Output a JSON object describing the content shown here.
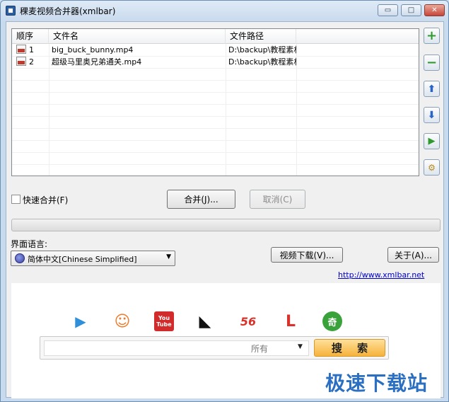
{
  "window": {
    "title": "稞麦视频合并器(xmlbar)",
    "minimize_glyph": "▭",
    "maximize_glyph": "□",
    "close_glyph": "✕"
  },
  "list": {
    "columns": [
      "顺序",
      "文件名",
      "文件路径",
      ""
    ],
    "rows": [
      {
        "order": "1",
        "filename": "big_buck_bunny.mp4",
        "path": "D:\\backup\\教程素材"
      },
      {
        "order": "2",
        "filename": "超级马里奥兄弟通关.mp4",
        "path": "D:\\backup\\教程素材"
      }
    ]
  },
  "side_buttons": {
    "add": "+",
    "remove": "−",
    "up": "⬆",
    "down": "⬇",
    "play": "▶",
    "settings": "⚙"
  },
  "options": {
    "fast_merge_label": "快速合并(F)",
    "fast_merge_checked": false
  },
  "actions": {
    "merge_label": "合并(J)...",
    "cancel_label": "取消(C)",
    "video_download_label": "视频下载(V)...",
    "about_label": "关于(A)..."
  },
  "progress": {
    "value": 0
  },
  "language": {
    "label": "界面语言:",
    "selected": "简体中文[Chinese Simplified]"
  },
  "link": {
    "text": "http://www.xmlbar.net"
  },
  "web_panel": {
    "site_icons": [
      {
        "name": "play-site",
        "glyph": "▶",
        "color": "#2f8fd8"
      },
      {
        "name": "tudou",
        "glyph": "☺",
        "color": "#f07a2a"
      },
      {
        "name": "youtube",
        "glyph": "You\nTube",
        "color": "#d22b2b"
      },
      {
        "name": "iqiyi-arrow",
        "glyph": "◣",
        "color": "#111111"
      },
      {
        "name": "56",
        "glyph": "56",
        "color": "#d8322b"
      },
      {
        "name": "letv",
        "glyph": "L",
        "color": "#d8322b"
      },
      {
        "name": "qi",
        "glyph": "奇",
        "color": "#3aa23a"
      }
    ],
    "search_placeholder": "",
    "search_scope": "所有",
    "search_button": "搜 索"
  },
  "watermark": "极速下载站"
}
